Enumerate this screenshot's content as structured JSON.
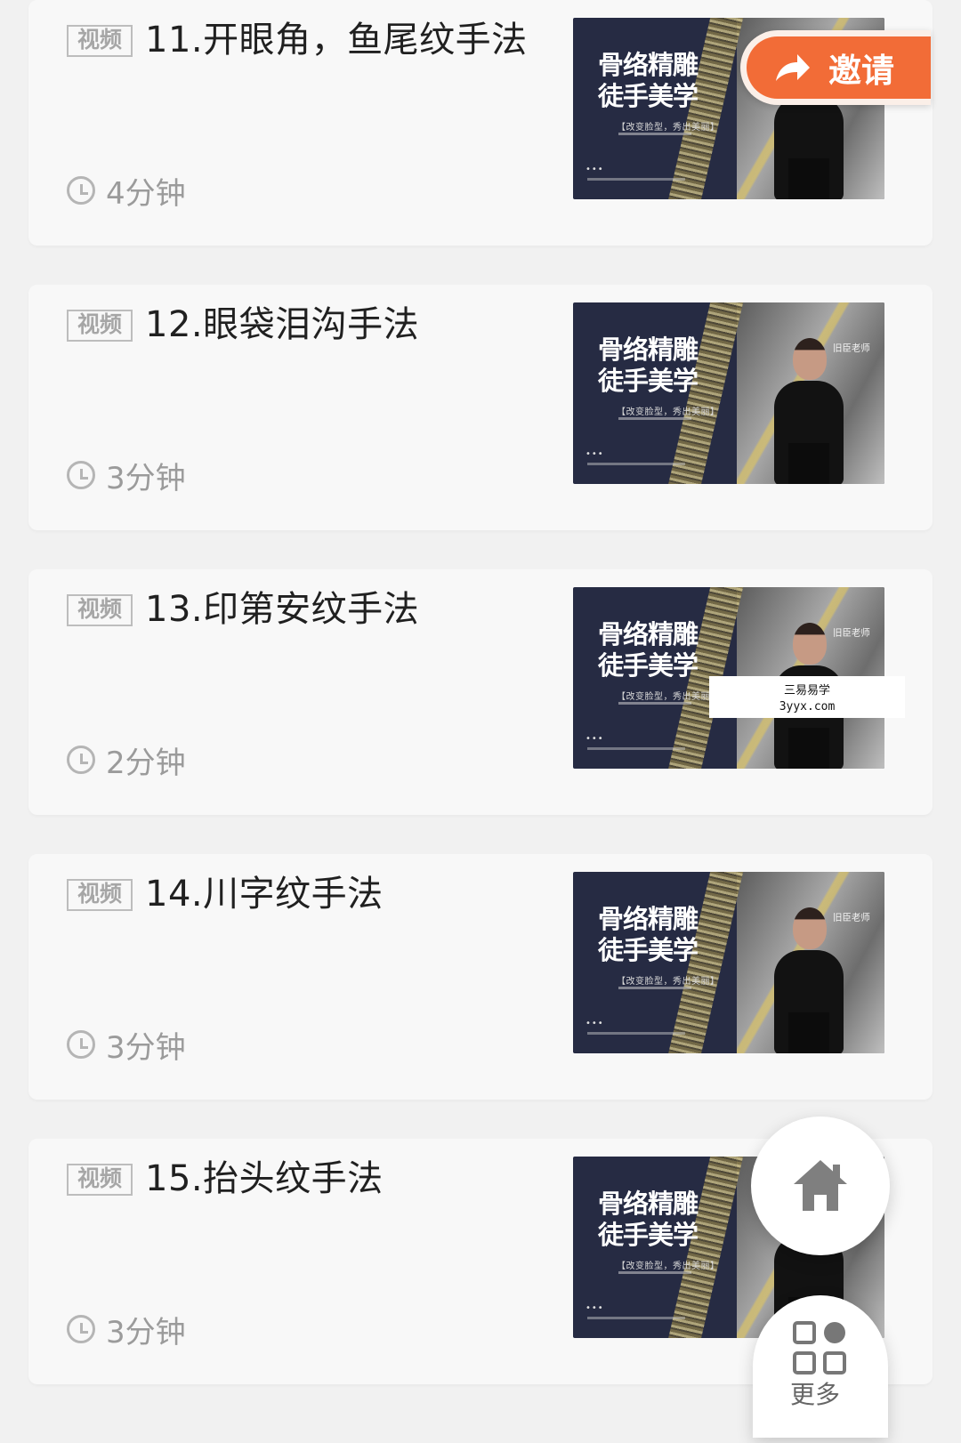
{
  "lessons": [
    {
      "tag": "视频",
      "title": "11.开眼角，鱼尾纹手法",
      "duration": "4分钟"
    },
    {
      "tag": "视频",
      "title": "12.眼袋泪沟手法",
      "duration": "3分钟"
    },
    {
      "tag": "视频",
      "title": "13.印第安纹手法",
      "duration": "2分钟"
    },
    {
      "tag": "视频",
      "title": "14.川字纹手法",
      "duration": "3分钟"
    },
    {
      "tag": "视频",
      "title": "15.抬头纹手法",
      "duration": "3分钟"
    }
  ],
  "thumbnail": {
    "title": "骨络精雕徒手美学",
    "subtitle": "【改变脸型，秀出美丽】",
    "teacher_label": "旧臣老师",
    "dots": "•••"
  },
  "actions": {
    "invite": "邀请",
    "more": "更多"
  },
  "watermark": {
    "line1": "三易易学",
    "line2": "3yyx.com"
  },
  "colors": {
    "accent_orange": "#f26c37",
    "thumbnail_navy": "#262b43",
    "background": "#f1f1f1"
  },
  "icons": {
    "duration": "clock-icon",
    "invite": "share-arrow-icon",
    "home": "home-icon",
    "more": "grid-more-icon"
  }
}
